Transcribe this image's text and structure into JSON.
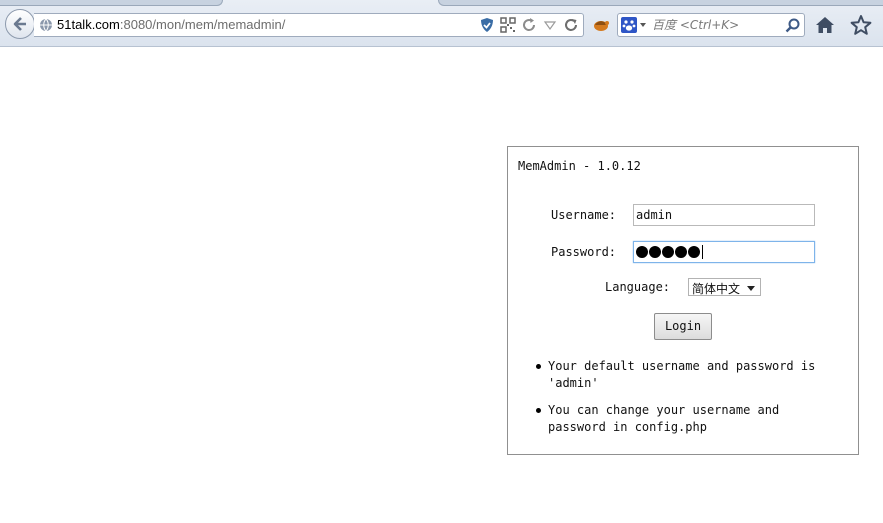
{
  "browser": {
    "url_host": "51talk.com",
    "url_rest": ":8080/mon/mem/memadmin/",
    "search_placeholder": "百度 <Ctrl+K>",
    "icons": [
      "back-icon",
      "globe-icon",
      "shield-icon",
      "qr-code-icon",
      "reload-icon",
      "dropdown-icon",
      "refresh-icon",
      "addon-icon",
      "baidu-icon",
      "search-icon",
      "home-icon",
      "star-icon"
    ]
  },
  "login": {
    "title": "MemAdmin - 1.0.12",
    "username_label": "Username:",
    "username_value": "admin",
    "password_label": "Password:",
    "password_length": 5,
    "language_label": "Language:",
    "language_value": "简体中文",
    "login_button": "Login",
    "notes": [
      "Your default username and password is 'admin'",
      "You can change your username and password in config.php"
    ]
  },
  "colors": {
    "panel_border": "#909090",
    "focus_border": "#7eb4ea",
    "toolbar_bg": "#dbe3ee"
  }
}
